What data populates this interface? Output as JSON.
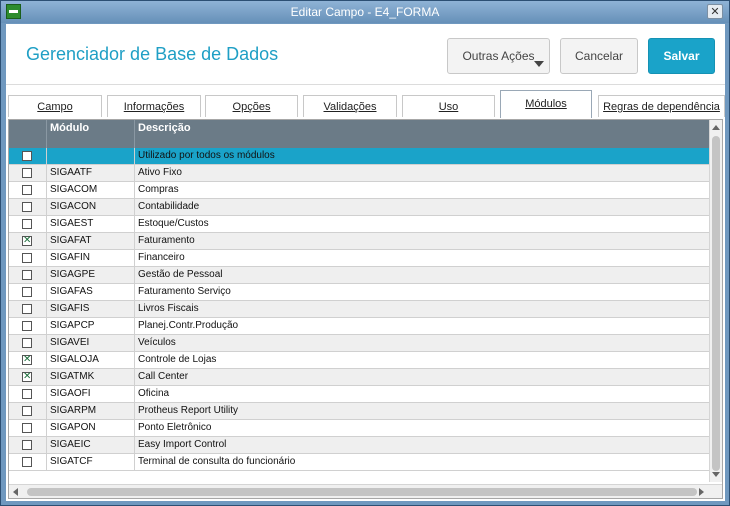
{
  "window": {
    "title": "Editar Campo - E4_FORMA",
    "close_glyph": "✕"
  },
  "header": {
    "title": "Gerenciador de Base de Dados",
    "other_actions_label": "Outras Ações",
    "cancel_label": "Cancelar",
    "save_label": "Salvar",
    "save_color": "#1aa3c9"
  },
  "tabs": [
    {
      "label": "Campo",
      "active": false
    },
    {
      "label": "Informações",
      "active": false
    },
    {
      "label": "Opções",
      "active": false
    },
    {
      "label": "Validações",
      "active": false
    },
    {
      "label": "Uso",
      "active": false
    },
    {
      "label": "Módulos",
      "active": true
    },
    {
      "label": "Regras de dependência",
      "active": false
    }
  ],
  "grid": {
    "columns": [
      "",
      "Módulo",
      "Descrição"
    ],
    "check_glyph": "✕",
    "rows": [
      {
        "checked": false,
        "module": "",
        "description": "Utilizado por todos os módulos",
        "selected": true
      },
      {
        "checked": false,
        "module": "SIGAATF",
        "description": "Ativo Fixo"
      },
      {
        "checked": false,
        "module": "SIGACOM",
        "description": "Compras"
      },
      {
        "checked": false,
        "module": "SIGACON",
        "description": "Contabilidade"
      },
      {
        "checked": false,
        "module": "SIGAEST",
        "description": "Estoque/Custos"
      },
      {
        "checked": true,
        "module": "SIGAFAT",
        "description": "Faturamento"
      },
      {
        "checked": false,
        "module": "SIGAFIN",
        "description": "Financeiro"
      },
      {
        "checked": false,
        "module": "SIGAGPE",
        "description": "Gestão de Pessoal"
      },
      {
        "checked": false,
        "module": "SIGAFAS",
        "description": "Faturamento Serviço"
      },
      {
        "checked": false,
        "module": "SIGAFIS",
        "description": "Livros Fiscais"
      },
      {
        "checked": false,
        "module": "SIGAPCP",
        "description": "Planej.Contr.Produção"
      },
      {
        "checked": false,
        "module": "SIGAVEI",
        "description": "Veículos"
      },
      {
        "checked": true,
        "module": "SIGALOJA",
        "description": "Controle de Lojas"
      },
      {
        "checked": true,
        "module": "SIGATMK",
        "description": "Call Center"
      },
      {
        "checked": false,
        "module": "SIGAOFI",
        "description": "Oficina"
      },
      {
        "checked": false,
        "module": "SIGARPM",
        "description": "Protheus Report Utility"
      },
      {
        "checked": false,
        "module": "SIGAPON",
        "description": "Ponto Eletrônico"
      },
      {
        "checked": false,
        "module": "SIGAEIC",
        "description": "Easy Import Control"
      },
      {
        "checked": false,
        "module": "SIGATCF",
        "description": "Terminal de consulta do funcionário"
      }
    ]
  }
}
